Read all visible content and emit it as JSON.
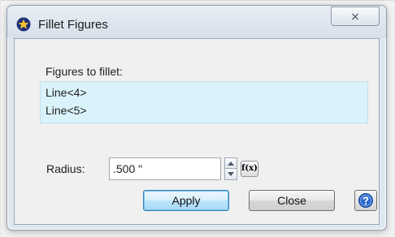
{
  "window": {
    "title": "Fillet Figures",
    "close_glyph": "⨯"
  },
  "figures": {
    "label": "Figures to fillet:",
    "items": [
      "Line<4>",
      "Line<5>"
    ]
  },
  "radius": {
    "label": "Radius:",
    "value": ".500 \""
  },
  "buttons": {
    "fx_label": "f(x)",
    "apply_label": "Apply",
    "close_label": "Close"
  },
  "icons": {
    "app": "star-icon",
    "help": "help-icon",
    "spin_up": "chevron-up-icon",
    "spin_down": "chevron-down-icon"
  },
  "colors": {
    "accent": "#3c7fb1",
    "list_bg": "#daf3fb"
  }
}
